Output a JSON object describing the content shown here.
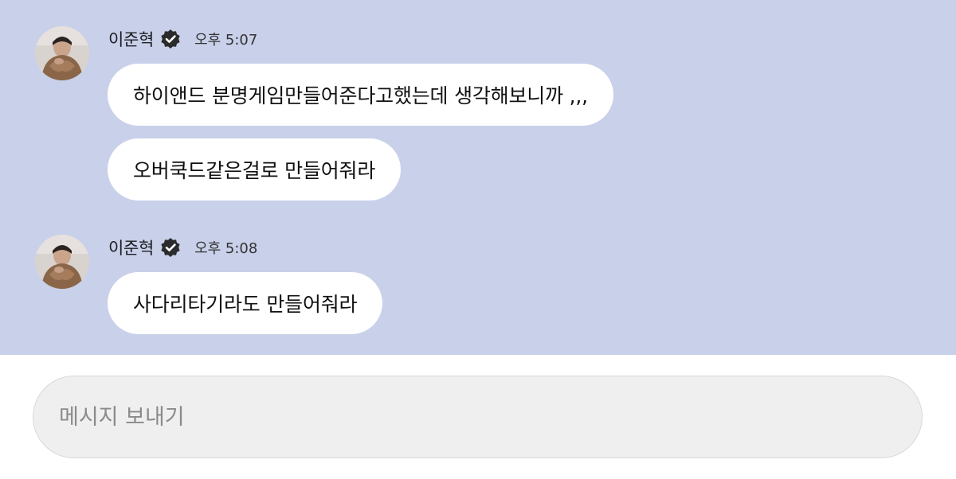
{
  "chat": {
    "background": "#c9d0ea",
    "groups": [
      {
        "sender": "이준혁",
        "verified": true,
        "time": "오후 5:07",
        "messages": [
          "하이앤드 분명게임만들어준다고했는데 생각해보니까 ,,,",
          "오버쿡드같은걸로 만들어줘라"
        ]
      },
      {
        "sender": "이준혁",
        "verified": true,
        "time": "오후 5:08",
        "messages": [
          "사다리타기라도 만들어줘라"
        ]
      }
    ]
  },
  "composer": {
    "placeholder": "메시지 보내기",
    "value": ""
  },
  "icons": {
    "verified": "verified-badge-icon",
    "avatar": "profile-photo"
  }
}
